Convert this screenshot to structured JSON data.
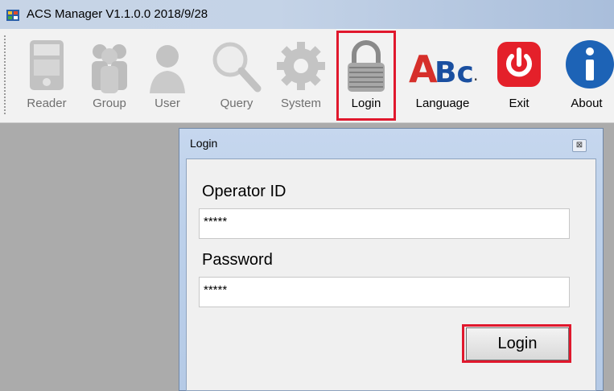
{
  "window": {
    "title": "ACS Manager V1.1.0.0  2018/9/28"
  },
  "toolbar": {
    "items": [
      {
        "label": "Reader",
        "icon": "reader-icon"
      },
      {
        "label": "Group",
        "icon": "group-icon"
      },
      {
        "label": "User",
        "icon": "user-icon"
      },
      {
        "label": "Query",
        "icon": "magnifier-icon"
      },
      {
        "label": "System",
        "icon": "gear-icon"
      },
      {
        "label": "Login",
        "icon": "padlock-icon"
      },
      {
        "label": "Language",
        "icon": "abc-icon"
      },
      {
        "label": "Exit",
        "icon": "power-icon"
      },
      {
        "label": "About",
        "icon": "info-icon"
      }
    ],
    "highlighted": "Login"
  },
  "dialog": {
    "title": "Login",
    "close_glyph": "⊠",
    "operator_label": "Operator ID",
    "operator_value": "*****",
    "password_label": "Password",
    "password_value": "*****",
    "submit_label": "Login"
  },
  "colors": {
    "highlight": "#e0182d",
    "exit_red": "#e4202a",
    "info_blue": "#1d63b6"
  }
}
